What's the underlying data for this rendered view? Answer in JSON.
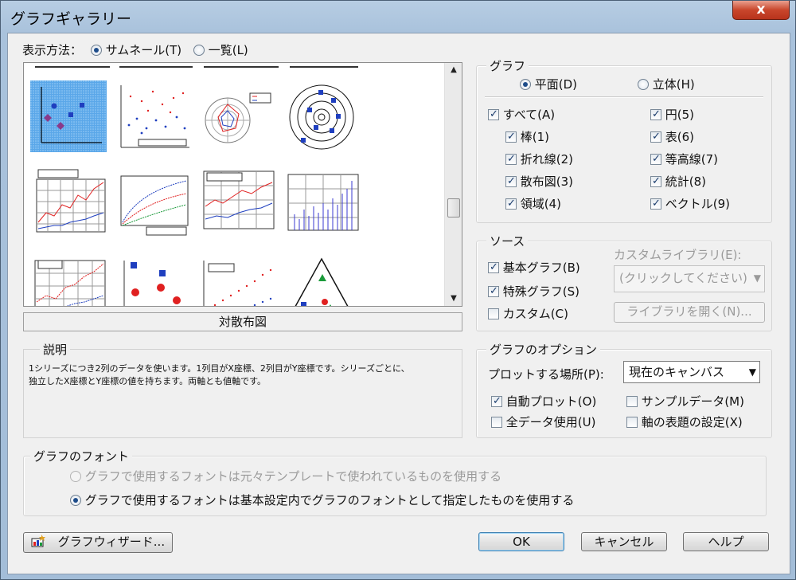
{
  "window": {
    "title": "グラフギャラリー",
    "close": "x"
  },
  "display_mode": {
    "label": "表示方法：",
    "thumbnail": "サムネール(T)",
    "list": "一覧(L)"
  },
  "gallery": {
    "selected_label": "対散布図",
    "thumbnails": [
      "log-scatter",
      "scatter-dots",
      "polar-radar",
      "polar-circles",
      "line-grid",
      "line-curves",
      "line-grid-2",
      "bar-columns",
      "line-grid-3",
      "scatter-shapes",
      "scatter-rising",
      "triangle-ternary"
    ]
  },
  "description": {
    "title": "説明",
    "text_line1": "1シリーズにつき2列のデータを使います。1列目がX座標、2列目がY座標です。シリーズごとに、",
    "text_line2": "独立したX座標とY座標の値を持ちます。両軸とも値軸です。"
  },
  "graph": {
    "title": "グラフ",
    "flat": "平面(D)",
    "solid": "立体(H)",
    "categories": {
      "all": "すべて(A)",
      "bar": "棒(1)",
      "line": "折れ線(2)",
      "scatter": "散布図(3)",
      "area": "領域(4)",
      "pie": "円(5)",
      "table": "表(6)",
      "contour": "等高線(7)",
      "stats": "統計(8)",
      "vector": "ベクトル(9)"
    }
  },
  "source": {
    "title": "ソース",
    "basic": "基本グラフ(B)",
    "special": "特殊グラフ(S)",
    "custom": "カスタム(C)",
    "custom_library_label": "カスタムライブラリ(E):",
    "custom_library_value": "(クリックしてください)",
    "open_library": "ライブラリを開く(N)..."
  },
  "options": {
    "title": "グラフのオプション",
    "plot_location_label": "プロットする場所(P):",
    "plot_location_value": "現在のキャンバス",
    "auto_plot": "自動プロット(O)",
    "sample_data": "サンプルデータ(M)",
    "use_all_data": "全データ使用(U)",
    "axis_title_settings": "軸の表題の設定(X)"
  },
  "font": {
    "title": "グラフのフォント",
    "option1": "グラフで使用するフォントは元々テンプレートで使われているものを使用する",
    "option2": "グラフで使用するフォントは基本設定内でグラフのフォントとして指定したものを使用する"
  },
  "footer": {
    "wizard": "グラフウィザード...",
    "ok": "OK",
    "cancel": "キャンセル",
    "help": "ヘルプ"
  },
  "colors": {
    "selection_blue": "#2f86d8",
    "marker_red": "#e02020",
    "marker_blue": "#1f3fbf",
    "marker_green": "#1a9a3a"
  }
}
